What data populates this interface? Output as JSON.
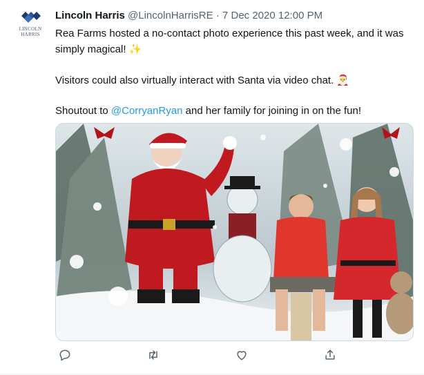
{
  "tweet": {
    "author_name": "Lincoln Harris",
    "handle": "@LincolnHarrisRE",
    "separator": "·",
    "timestamp": "7 Dec 2020 12:00 PM",
    "logo_text_top": "LINCOLN",
    "logo_text_bottom": "HARRIS",
    "line1": "Rea Farms hosted a no-contact photo experience this past week, and it was simply magical!",
    "line1_emoji": "✨",
    "line2": "Visitors could also virtually interact with Santa via video chat.",
    "line2_emoji": "🎅",
    "line3_prefix": "Shoutout to",
    "line3_mention": "@CorryanRyan",
    "line3_suffix": "and her family for joining in on the fun!"
  },
  "actions": {
    "reply_icon": "reply-icon",
    "retweet_icon": "retweet-icon",
    "like_icon": "heart-icon",
    "share_icon": "share-icon"
  },
  "colors": {
    "mention": "#1d9bf0",
    "muted": "#536471",
    "logo_blue": "#1f3b6e",
    "santa_red": "#c0191f",
    "kids_red": "#d6282c"
  }
}
